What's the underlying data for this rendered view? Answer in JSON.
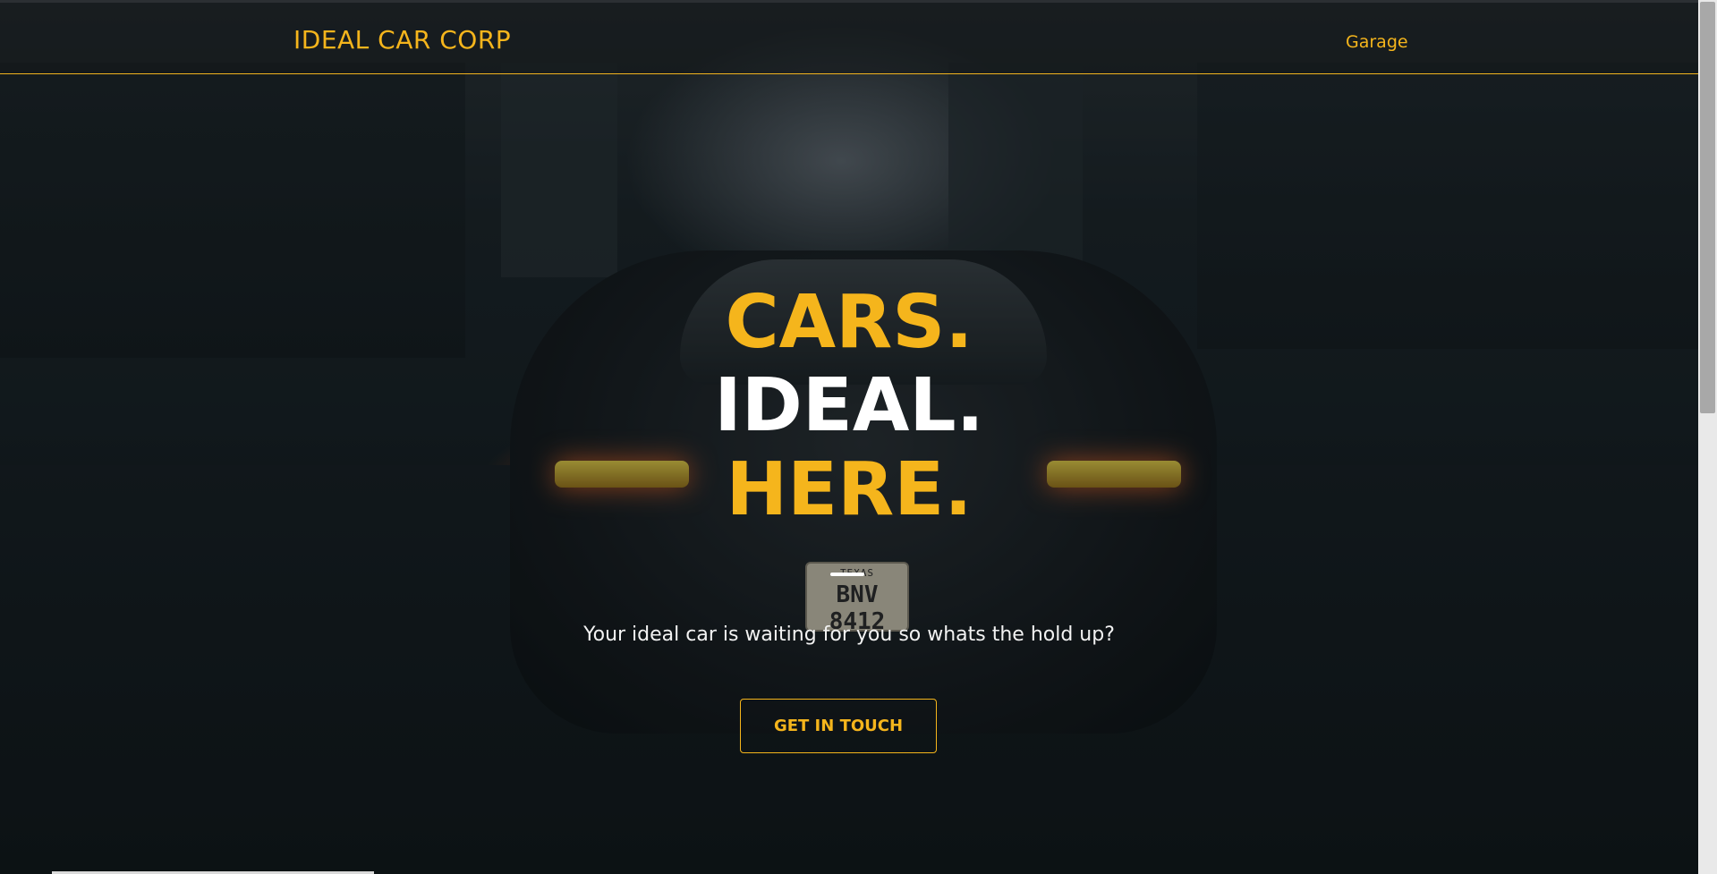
{
  "navbar": {
    "brand": "IDEAL CAR CORP",
    "links": [
      {
        "label": "Garage"
      }
    ]
  },
  "hero": {
    "headline": [
      "CARS.",
      "IDEAL.",
      "HERE."
    ],
    "tagline": "Your ideal car is waiting for you so whats the hold up?",
    "cta_label": "GET IN TOUCH",
    "plate": {
      "state": "TEXAS",
      "number": "BNV 8412"
    }
  },
  "colors": {
    "accent": "#f5b51c",
    "headline_white": "#ffffff",
    "tagline": "#f2f2f2"
  }
}
